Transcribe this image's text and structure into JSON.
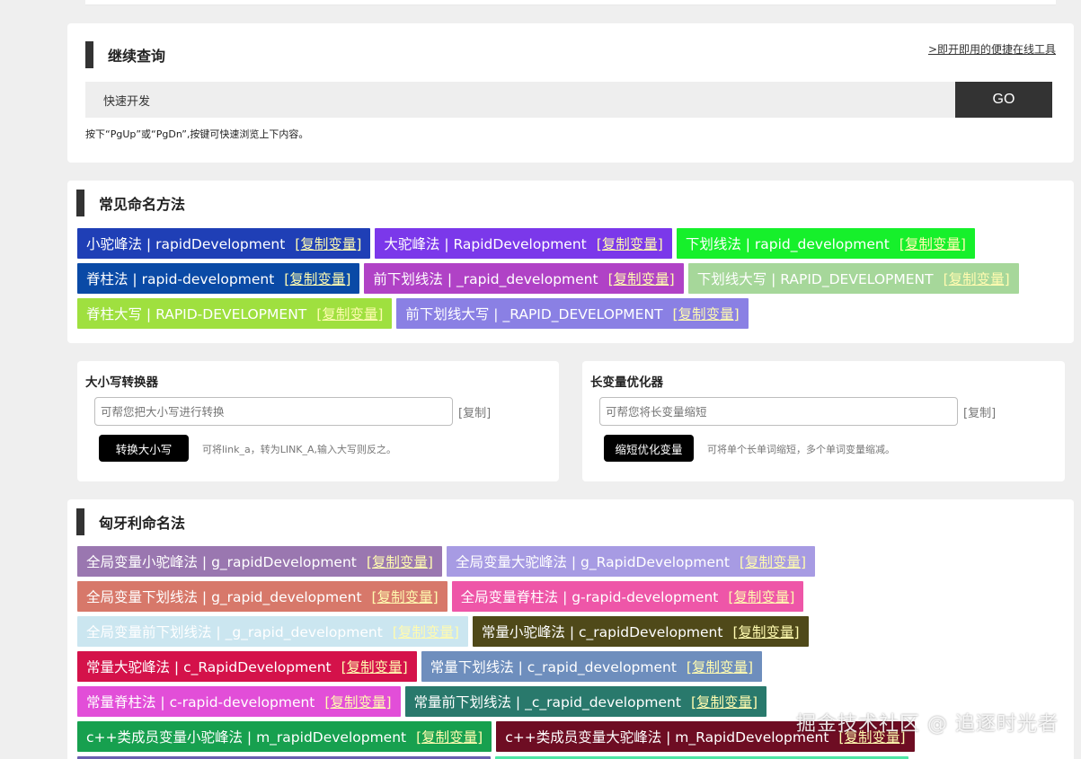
{
  "search": {
    "title": "继续查询",
    "tool_link": ">即开即用的便捷在线工具",
    "input_value": "快速开发",
    "go_label": "GO",
    "hint": "按下“PgUp”或“PgDn”,按键可快速浏览上下内容。"
  },
  "naming": {
    "title": "常见命名方法",
    "tags": [
      {
        "label": "小驼峰法 | rapidDevelopment",
        "copy": "[复制变量]",
        "color": "#1f3fb6"
      },
      {
        "label": "大驼峰法 | RapidDevelopment",
        "copy": "[复制变量]",
        "color": "#7b38ea"
      },
      {
        "label": "下划线法 | rapid_development",
        "copy": "[复制变量]",
        "color": "#16f02b"
      },
      {
        "label": "脊柱法 | rapid-development",
        "copy": "[复制变量]",
        "color": "#0a4aa6"
      },
      {
        "label": "前下划线法 | _rapid_development",
        "copy": "[复制变量]",
        "color": "#b042c6"
      },
      {
        "label": "下划线大写 | RAPID_DEVELOPMENT",
        "copy": "[复制变量]",
        "color": "#a6d79a"
      },
      {
        "label": "脊柱大写 | RAPID-DEVELOPMENT",
        "copy": "[复制变量]",
        "color": "#9fe03f"
      },
      {
        "label": "前下划线大写 | _RAPID_DEVELOPMENT",
        "copy": "[复制变量]",
        "color": "#8a80e4"
      }
    ]
  },
  "case_tool": {
    "title": "大小写转换器",
    "placeholder": "可帮您把大小写进行转换",
    "copy": "[复制]",
    "button": "转换大小写",
    "desc": "可将link_a，转为LINK_A,输入大写则反之。"
  },
  "opt_tool": {
    "title": "长变量优化器",
    "placeholder": "可帮您将长变量缩短",
    "copy": "[复制]",
    "button": "缩短优化变量",
    "desc": "可将单个长单词缩短，多个单词变量缩减。"
  },
  "hungarian": {
    "title": "匈牙利命名法",
    "tags": [
      {
        "label": "全局变量小驼峰法 | g_rapidDevelopment",
        "copy": "[复制变量]",
        "color": "#9a77b0"
      },
      {
        "label": "全局变量大驼峰法 | g_RapidDevelopment",
        "copy": "[复制变量]",
        "color": "#a79be3"
      },
      {
        "label": "全局变量下划线法 | g_rapid_development",
        "copy": "[复制变量]",
        "color": "#d7786a"
      },
      {
        "label": "全局变量脊柱法 | g-rapid-development",
        "copy": "[复制变量]",
        "color": "#ee56a8"
      },
      {
        "label": "全局变量前下划线法 | _g_rapid_development",
        "copy": "[复制变量]",
        "color": "#cbe6f0"
      },
      {
        "label": "常量小驼峰法 | c_rapidDevelopment",
        "copy": "[复制变量]",
        "color": "#4f4919"
      },
      {
        "label": "常量大驼峰法 | c_RapidDevelopment",
        "copy": "[复制变量]",
        "color": "#d4124a"
      },
      {
        "label": "常量下划线法 | c_rapid_development",
        "copy": "[复制变量]",
        "color": "#6e8ebd"
      },
      {
        "label": "常量脊柱法 | c-rapid-development",
        "copy": "[复制变量]",
        "color": "#e24ed8"
      },
      {
        "label": "常量前下划线法 | _c_rapid_development",
        "copy": "[复制变量]",
        "color": "#29796c"
      },
      {
        "label": "c++类成员变量小驼峰法 | m_rapidDevelopment",
        "copy": "[复制变量]",
        "color": "#17a04f"
      },
      {
        "label": "c++类成员变量大驼峰法 | m_RapidDevelopment",
        "copy": "[复制变量]",
        "color": "#6e0d23"
      },
      {
        "label": "",
        "copy": "",
        "color": "#6a5fb0"
      },
      {
        "label": "",
        "copy": "",
        "color": "#4fe6a6"
      }
    ]
  },
  "watermark": "掘金技术社区 @ 追逐时光者"
}
